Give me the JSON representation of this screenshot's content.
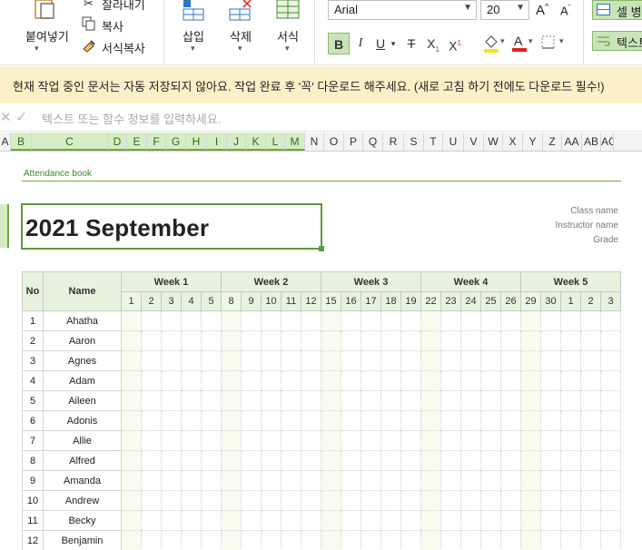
{
  "ribbon": {
    "pages_label": "붙여넣기",
    "cut_label": "잘라내기",
    "copy_label": "복사",
    "format_painter_label": "서식복사",
    "insert_label": "삽입",
    "delete_label": "삭제",
    "format_label": "서식",
    "font_name": "Arial",
    "font_size": "20",
    "grow_font": "A",
    "shrink_font": "A",
    "bold": "B",
    "italic": "I",
    "underline": "U",
    "strike": "T",
    "subscript": "X",
    "superscript": "X",
    "merge_label": "셀 병",
    "text_label": "텍스트"
  },
  "notice": "현재 작업 중인 문서는 자동 저장되지 않아요. 작업 완료 후 '꼭' 다운로드 해주세요. (새로 고침 하기 전에도 다운로드 필수!)",
  "formula_bar": {
    "placeholder": "텍스트 또는 함수 정보를 입력하세요."
  },
  "columns": [
    "A",
    "B",
    "C",
    "D",
    "E",
    "F",
    "G",
    "H",
    "I",
    "J",
    "K",
    "L",
    "M",
    "N",
    "O",
    "P",
    "Q",
    "R",
    "S",
    "T",
    "U",
    "V",
    "W",
    "X",
    "Y",
    "Z",
    "AA",
    "AB",
    "AC"
  ],
  "sheet": {
    "attendance_label": "Attendance book",
    "title": "2021 September",
    "class_name_label": "Class name",
    "instructor_label": "Instructor name",
    "grade_label": "Grade",
    "no_header": "No",
    "name_header": "Name",
    "weeks": [
      "Week 1",
      "Week 2",
      "Week 3",
      "Week 4",
      "Week 5"
    ],
    "days": [
      "1",
      "2",
      "3",
      "4",
      "5",
      "8",
      "9",
      "10",
      "11",
      "12",
      "15",
      "16",
      "17",
      "18",
      "19",
      "22",
      "23",
      "24",
      "25",
      "26",
      "29",
      "30",
      "1",
      "2",
      "3"
    ],
    "students": [
      {
        "no": "1",
        "name": "Ahatha"
      },
      {
        "no": "2",
        "name": "Aaron"
      },
      {
        "no": "3",
        "name": "Agnes"
      },
      {
        "no": "4",
        "name": "Adam"
      },
      {
        "no": "5",
        "name": "Aileen"
      },
      {
        "no": "6",
        "name": "Adonis"
      },
      {
        "no": "7",
        "name": "Allie"
      },
      {
        "no": "8",
        "name": "Alfred"
      },
      {
        "no": "9",
        "name": "Amanda"
      },
      {
        "no": "10",
        "name": "Andrew"
      },
      {
        "no": "11",
        "name": "Becky"
      },
      {
        "no": "12",
        "name": "Benjamin"
      }
    ]
  },
  "colors": {
    "accent": "#6aaa3a",
    "header_fill": "#e8f3df",
    "notice_bg": "#fcf0c8"
  }
}
